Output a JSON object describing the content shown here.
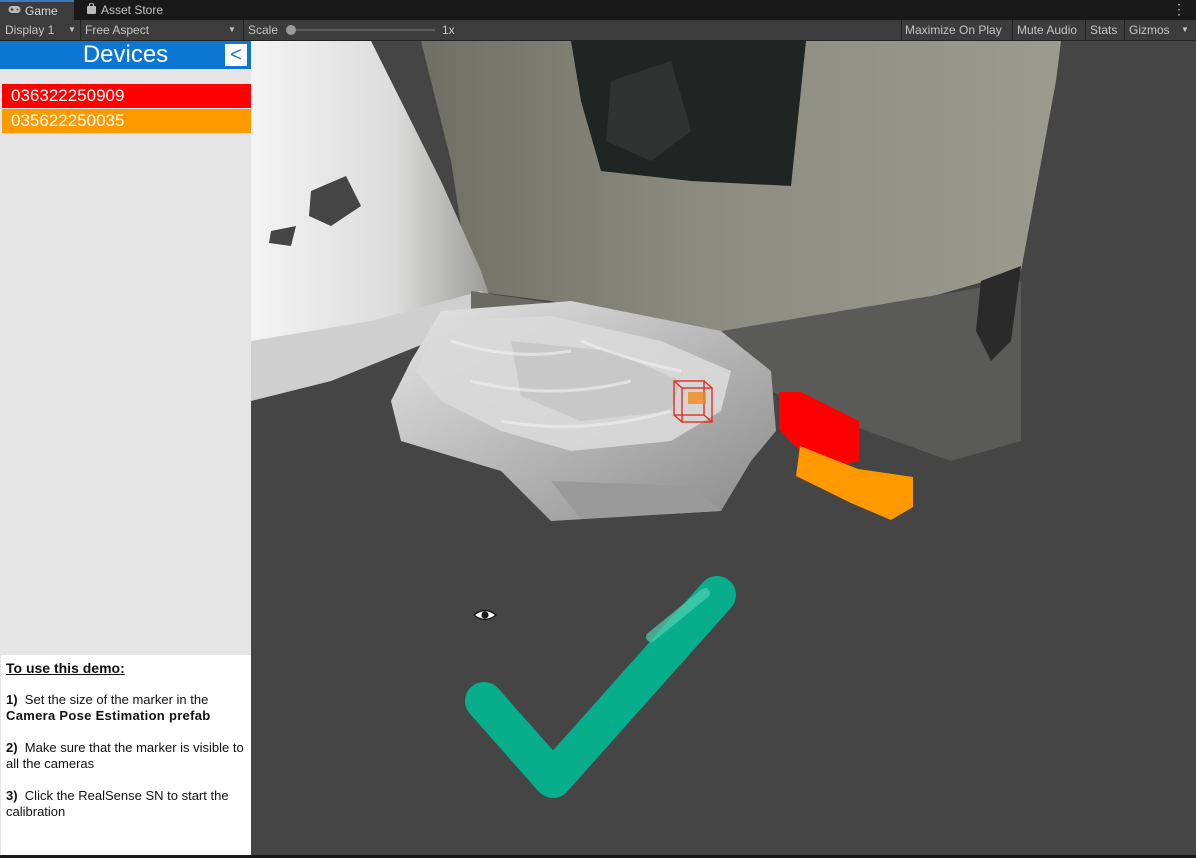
{
  "tabs": [
    {
      "label": "Game",
      "icon": "gamepad-icon",
      "active": true
    },
    {
      "label": "Asset Store",
      "icon": "shopping-bag-icon",
      "active": false
    }
  ],
  "toolbar": {
    "display": "Display 1",
    "aspect": "Free Aspect",
    "scale_label": "Scale",
    "scale_value": "1x",
    "maximize": "Maximize On Play",
    "mute": "Mute Audio",
    "stats": "Stats",
    "gizmos": "Gizmos"
  },
  "panel": {
    "title": "Devices",
    "collapse_label": "<",
    "devices": [
      {
        "serial": "036322250909",
        "color": "#ff0000"
      },
      {
        "serial": "035622250035",
        "color": "#ff9900"
      }
    ],
    "instructions": {
      "heading": "To use this demo:",
      "step1_num": "1)",
      "step1_text": "Set the size of the marker in the",
      "step1_bold": "Camera Pose Estimation prefab",
      "step2_num": "2)",
      "step2_text": "Make sure that the marker is visible to all the cameras",
      "step3_num": "3)",
      "step3_text": "Click the RealSense SN to start the calibration"
    }
  },
  "scene": {
    "checkmark_color": "#08ad8c",
    "icons": [
      "eye-icon",
      "checkmark-icon"
    ]
  }
}
